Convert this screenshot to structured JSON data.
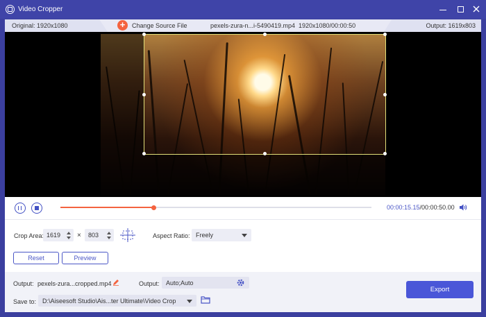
{
  "window": {
    "title": "Video Cropper",
    "icons": {
      "app": "crop-app-icon",
      "minimize": "minimize-icon",
      "maximize": "maximize-icon",
      "close": "close-icon"
    }
  },
  "info_bar": {
    "original_label": "Original: 1920x1080",
    "change_source_label": "Change Source File",
    "file_name": "pexels-zura-n...i-5490419.mp4",
    "file_info": "1920x1080/00:00:50",
    "output_label": "Output: 1619x803"
  },
  "playback": {
    "current_time": "00:00:15.15",
    "total_time": "/00:00:50.00",
    "progress": 0.3
  },
  "crop": {
    "area_label": "Crop Area:",
    "width": "1619",
    "x_sign": "×",
    "height": "803",
    "aspect_label": "Aspect Ratio:",
    "aspect_value": "Freely"
  },
  "buttons": {
    "reset": "Reset",
    "preview": "Preview",
    "export": "Export"
  },
  "output": {
    "file_label": "Output:",
    "file_name": "pexels-zura...cropped.mp4",
    "format_label": "Output:",
    "format_value": "Auto;Auto",
    "save_label": "Save to:",
    "save_path": "D:\\Aiseesoft Studio\\Ais...ter Ultimate\\Video Crop"
  },
  "colors": {
    "accent": "#4a56c6",
    "title_bar": "#3f44a8",
    "progress": "#f4633f",
    "crop_border": "#e3e07a"
  }
}
